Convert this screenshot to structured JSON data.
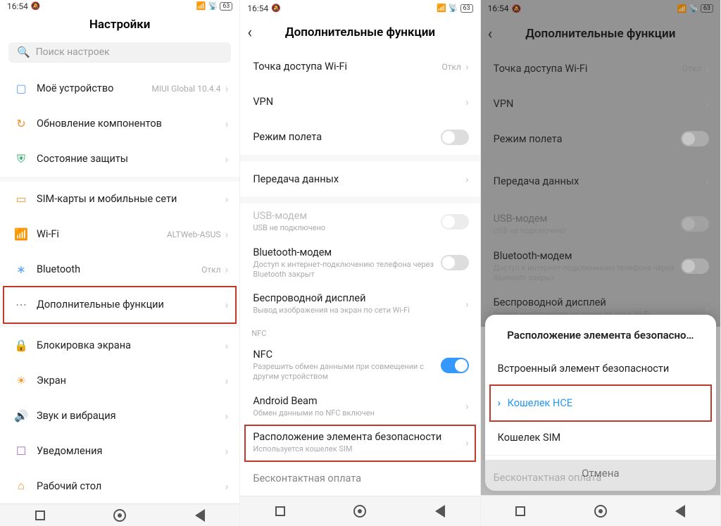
{
  "status": {
    "time": "16:54",
    "battery": "63"
  },
  "screen1": {
    "title": "Настройки",
    "search_placeholder": "Поиск настроек",
    "rows": {
      "device": {
        "label": "Моё устройство",
        "value": "MIUI Global 10.4.4"
      },
      "update": {
        "label": "Обновление компонентов"
      },
      "security": {
        "label": "Состояние защиты"
      },
      "sim": {
        "label": "SIM-карты и мобильные сети"
      },
      "wifi": {
        "label": "Wi-Fi",
        "value": "ALTWeb-ASUS"
      },
      "bt": {
        "label": "Bluetooth",
        "value": "Откл"
      },
      "more": {
        "label": "Дополнительные функции"
      },
      "lock": {
        "label": "Блокировка экрана"
      },
      "display": {
        "label": "Экран"
      },
      "sound": {
        "label": "Звук и вибрация"
      },
      "notify": {
        "label": "Уведомления"
      },
      "desktop": {
        "label": "Рабочий стол"
      }
    }
  },
  "screen2": {
    "title": "Дополнительные функции",
    "rows": {
      "hotspot": {
        "label": "Точка доступа Wi-Fi",
        "value": "Откл"
      },
      "vpn": {
        "label": "VPN"
      },
      "airplane": {
        "label": "Режим полета"
      },
      "data": {
        "label": "Передача данных"
      },
      "usb": {
        "label": "USB-модем",
        "sub": "USB не подключено"
      },
      "btmodem": {
        "label": "Bluetooth-модем",
        "sub": "Доступ к интернет-подключению телефона через Bluetooth закрыт"
      },
      "cast": {
        "label": "Беспроводной дисплей",
        "sub": "Вывод изображения на экран по сети Wi-Fi"
      },
      "nfc_section": "NFC",
      "nfc": {
        "label": "NFC",
        "sub": "Разрешить обмен данными при совмещении с другим устройством"
      },
      "beam": {
        "label": "Android Beam",
        "sub": "Обмен данными по NFC включен"
      },
      "se": {
        "label": "Расположение элемента безопасности",
        "sub": "Используется кошелек SIM"
      },
      "contactless": {
        "label": "Бесконтактная оплата"
      }
    }
  },
  "sheet": {
    "title": "Расположение элемента безопасно…",
    "opt_builtin": "Встроенный элемент безопасности",
    "opt_hce": "Кошелек HCE",
    "opt_sim": "Кошелек SIM",
    "cancel": "Отмена"
  }
}
